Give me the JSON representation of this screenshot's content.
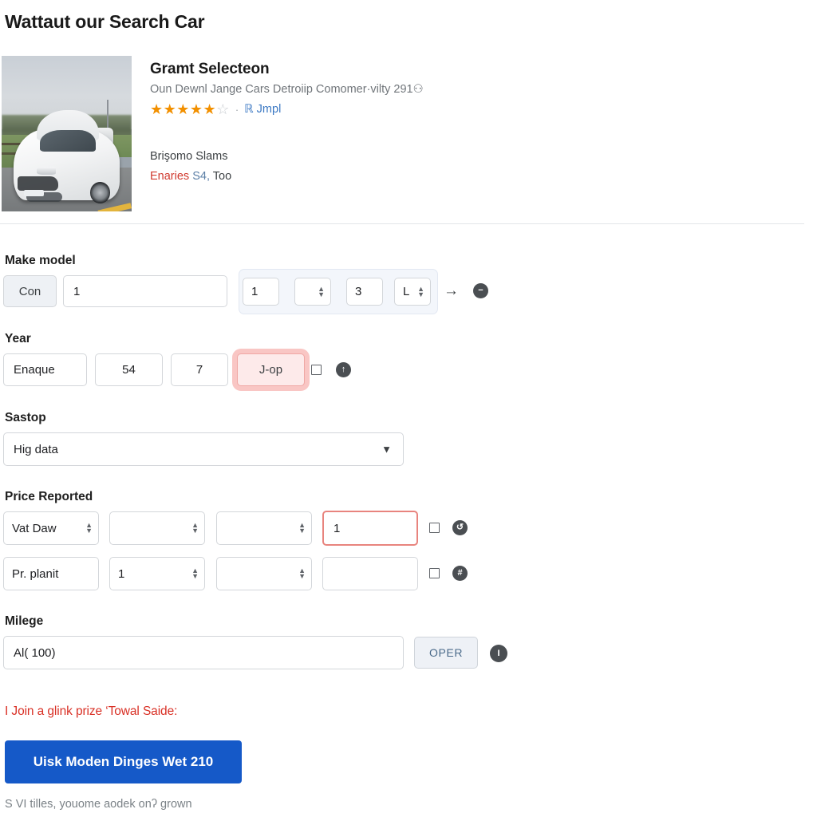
{
  "page": {
    "title": "Wattaut our Search Car"
  },
  "product": {
    "title": "Gramt Selecteon",
    "subtitle": "Oun Dewnl Jange Cars Detroiip Comomer·vilty 291⚇",
    "rating": {
      "filled_stars": 5,
      "empty_stars": 1,
      "separator": "·",
      "link_label": "ℝ Jmpl"
    },
    "meta_line1": "Brişomo Slams",
    "meta_line2_red": "Enaries",
    "meta_line2_blue": "S4,",
    "meta_line2_dark": "Too",
    "photo_alt": "white-sedan-on-road"
  },
  "sections": {
    "make_model": {
      "label": "Make model",
      "button_label": "Con",
      "text_value": "1",
      "spin_group": {
        "field1": "1",
        "field2": "",
        "field3": "3",
        "field4": "L"
      },
      "arrow_icon": "→",
      "minus_icon": "−"
    },
    "year": {
      "label": "Year",
      "field1": "Enaque",
      "field2": "54",
      "field3": "7",
      "field4_highlighted": "J-op",
      "checkbox_checked": false,
      "circle_icon": "↑"
    },
    "sastop": {
      "label": "Sastop",
      "select_value": "Hig data",
      "caret_icon": "⌄"
    },
    "price_reported": {
      "label": "Price Reported",
      "rows": [
        {
          "field1": "Vat Daw",
          "field2": "",
          "field3": "",
          "field4": "1",
          "field4_highlighted": true,
          "checkbox_checked": false,
          "circle_icon": "↺"
        },
        {
          "field1": "Pr. planit",
          "field2": "1",
          "field3": "",
          "field4": "",
          "field4_highlighted": false,
          "checkbox_checked": false,
          "circle_icon": "#"
        }
      ]
    },
    "milege": {
      "label": "Milege",
      "input_value": "Al( 100)",
      "oper_button_label": "OPER",
      "info_icon": "I"
    }
  },
  "footer": {
    "error_message": "I Join a glink prize ‘Towal Saide:",
    "submit_label": "Uisk Moden Dinges Wet 210",
    "note": "S VI tilles, youome aodek onʔ grown"
  },
  "colors": {
    "accent_blue": "#1559c8",
    "error_red": "#d93025",
    "star_orange": "#f29000",
    "link_blue": "#3b78c3",
    "highlight_pink": "#f0a7a4"
  }
}
